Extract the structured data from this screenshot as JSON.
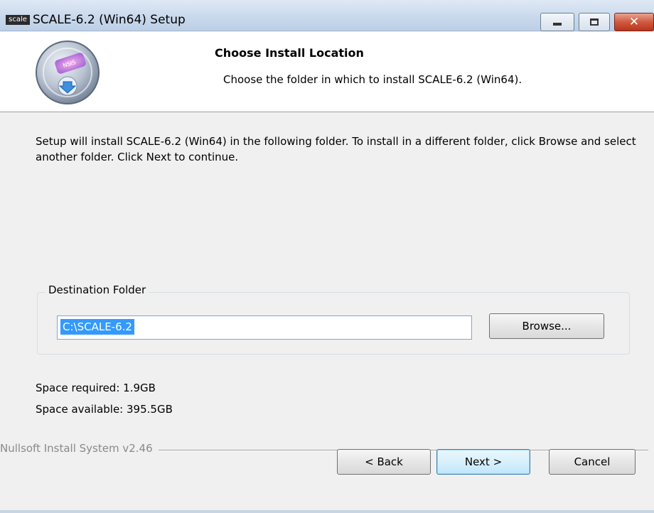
{
  "window": {
    "app_icon_text": "scale",
    "title": "SCALE-6.2 (Win64) Setup",
    "controls": [
      "minimize-icon",
      "maximize-icon",
      "close-icon"
    ]
  },
  "header": {
    "title": "Choose Install Location",
    "subtitle": "Choose the folder in which to install SCALE-6.2 (Win64).",
    "icon": "installer-disc-icon"
  },
  "intro_text": "Setup will install SCALE-6.2 (Win64) in the following folder. To install in a different folder, click Browse and select another folder. Click Next to continue.",
  "destination": {
    "legend": "Destination Folder",
    "path_value": "C:\\SCALE-6.2",
    "browse_label": "Browse..."
  },
  "space": {
    "required": "Space required: 1.9GB",
    "available": "Space available: 395.5GB"
  },
  "branding": "Nullsoft Install System v2.46",
  "buttons": {
    "back": "< Back",
    "next": "Next >",
    "cancel": "Cancel"
  },
  "colors": {
    "selection": "#3399ff",
    "close_button": "#c8452b"
  }
}
